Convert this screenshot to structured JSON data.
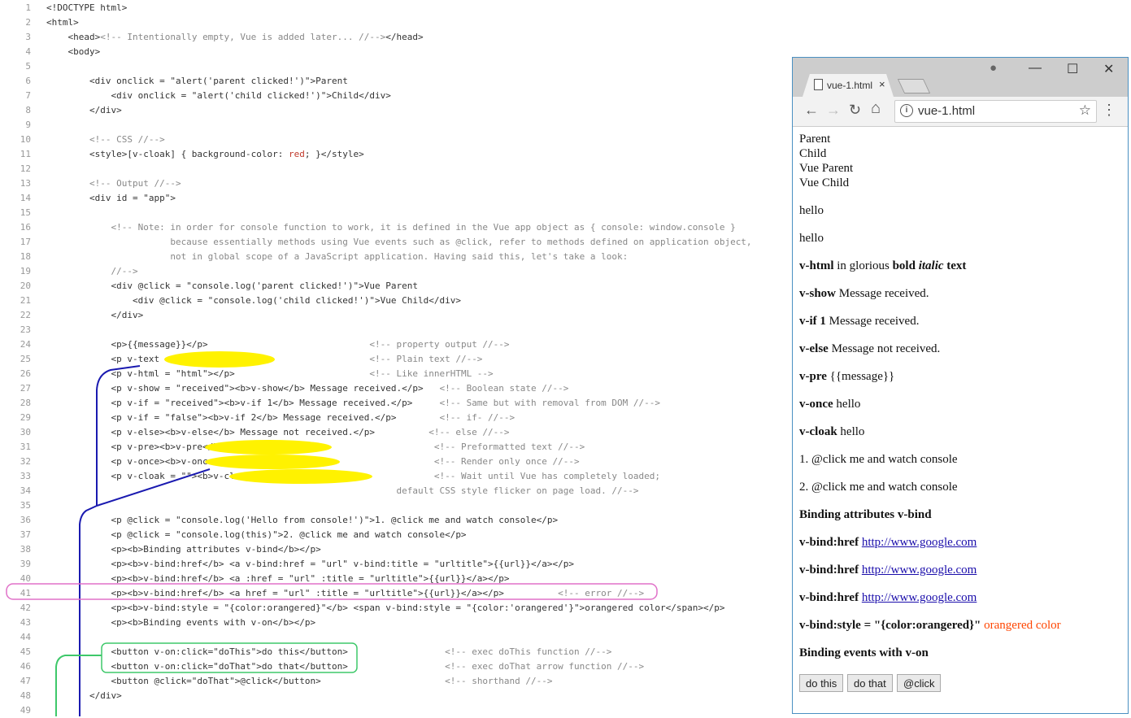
{
  "editor": {
    "lines": [
      {
        "n": "1",
        "segs": [
          [
            "t",
            "<!DOCTYPE html>"
          ]
        ]
      },
      {
        "n": "2",
        "segs": [
          [
            "t",
            "<html>"
          ]
        ]
      },
      {
        "n": "3",
        "segs": [
          [
            "t",
            "    <head>"
          ],
          [
            "c",
            "<!-- Intentionally empty, Vue is added later... //-->"
          ],
          [
            "t",
            "</head>"
          ]
        ]
      },
      {
        "n": "4",
        "segs": [
          [
            "t",
            "    <body>"
          ]
        ]
      },
      {
        "n": "5",
        "segs": []
      },
      {
        "n": "6",
        "segs": [
          [
            "t",
            "        <div onclick = \"alert('parent clicked!')\">Parent"
          ]
        ]
      },
      {
        "n": "7",
        "segs": [
          [
            "t",
            "            <div onclick = \"alert('child clicked!')\">Child</div>"
          ]
        ]
      },
      {
        "n": "8",
        "segs": [
          [
            "t",
            "        </div>"
          ]
        ]
      },
      {
        "n": "9",
        "segs": []
      },
      {
        "n": "10",
        "segs": [
          [
            "c",
            "        <!-- CSS //-->"
          ]
        ]
      },
      {
        "n": "11",
        "segs": [
          [
            "t",
            "        <style>[v-cloak] { background-color: "
          ],
          [
            "r",
            "red"
          ],
          [
            "t",
            "; }</style>"
          ]
        ]
      },
      {
        "n": "12",
        "segs": []
      },
      {
        "n": "13",
        "segs": [
          [
            "c",
            "        <!-- Output //-->"
          ]
        ]
      },
      {
        "n": "14",
        "segs": [
          [
            "t",
            "        <div id = \"app\">"
          ]
        ]
      },
      {
        "n": "15",
        "segs": []
      },
      {
        "n": "16",
        "segs": [
          [
            "c",
            "            <!-- Note: in order for console function to work, it is defined in the Vue app object as { console: window.console }"
          ]
        ]
      },
      {
        "n": "17",
        "segs": [
          [
            "c",
            "                       because essentially methods using Vue events such as @click, refer to methods defined on application object,"
          ]
        ]
      },
      {
        "n": "18",
        "segs": [
          [
            "c",
            "                       not in global scope of a JavaScript application. Having said this, let's take a look:"
          ]
        ]
      },
      {
        "n": "19",
        "segs": [
          [
            "c",
            "            //-->"
          ]
        ]
      },
      {
        "n": "20",
        "segs": [
          [
            "t",
            "            <div @click = \"console.log('parent clicked!')\">Vue Parent"
          ]
        ]
      },
      {
        "n": "21",
        "segs": [
          [
            "t",
            "                <div @click = \"console.log('child clicked!')\">Vue Child</div>"
          ]
        ]
      },
      {
        "n": "22",
        "segs": [
          [
            "t",
            "            </div>"
          ]
        ]
      },
      {
        "n": "23",
        "segs": []
      },
      {
        "n": "24",
        "segs": [
          [
            "t",
            "            <p>{{message}}</p>                              "
          ],
          [
            "c",
            "<!-- property output //-->"
          ]
        ]
      },
      {
        "n": "25",
        "segs": [
          [
            "t",
            "            <p v-text = \"message\"></p>                      "
          ],
          [
            "c",
            "<!-- Plain text //-->"
          ]
        ]
      },
      {
        "n": "26",
        "segs": [
          [
            "t",
            "            <p v-html = \"html\"></p>                         "
          ],
          [
            "c",
            "<!-- Like innerHTML -->"
          ]
        ]
      },
      {
        "n": "27",
        "segs": [
          [
            "t",
            "            <p v-show = \"received\"><b>v-show</b> Message received.</p>   "
          ],
          [
            "c",
            "<!-- Boolean state //-->"
          ]
        ]
      },
      {
        "n": "28",
        "segs": [
          [
            "t",
            "            <p v-if = \"received\"><b>v-if 1</b> Message received.</p>     "
          ],
          [
            "c",
            "<!-- Same but with removal from DOM //-->"
          ]
        ]
      },
      {
        "n": "29",
        "segs": [
          [
            "t",
            "            <p v-if = \"false\"><b>v-if 2</b> Message received.</p>        "
          ],
          [
            "c",
            "<!-- if- //-->"
          ]
        ]
      },
      {
        "n": "30",
        "segs": [
          [
            "t",
            "            <p v-else><b>v-else</b> Message not received.</p>          "
          ],
          [
            "c",
            "<!-- else //-->"
          ]
        ]
      },
      {
        "n": "31",
        "segs": [
          [
            "t",
            "            <p v-pre><b>v-pre</b> {{message}}</p>                       "
          ],
          [
            "c",
            "<!-- Preformatted text //-->"
          ]
        ]
      },
      {
        "n": "32",
        "segs": [
          [
            "t",
            "            <p v-once><b>v-once</b> {{message}}</p>                     "
          ],
          [
            "c",
            "<!-- Render only once //-->"
          ]
        ]
      },
      {
        "n": "33",
        "segs": [
          [
            "t",
            "            <p v-cloak = \"\"><b>v-cloak</b> {{message}}</p>              "
          ],
          [
            "c",
            "<!-- Wait until Vue has completely loaded;"
          ]
        ]
      },
      {
        "n": "34",
        "segs": [
          [
            "c",
            "                                                                 default CSS style flicker on page load. //-->"
          ]
        ]
      },
      {
        "n": "35",
        "segs": []
      },
      {
        "n": "36",
        "segs": [
          [
            "t",
            "            <p @click = \"console.log('Hello from console!')\">1. @click me and watch console</p>"
          ]
        ]
      },
      {
        "n": "37",
        "segs": [
          [
            "t",
            "            <p @click = \"console.log(this)\">2. @click me and watch console</p>"
          ]
        ]
      },
      {
        "n": "38",
        "segs": [
          [
            "t",
            "            <p><b>Binding attributes v-bind</b></p>"
          ]
        ]
      },
      {
        "n": "39",
        "segs": [
          [
            "t",
            "            <p><b>v-bind:href</b> <a v-bind:href = \"url\" v-bind:title = \"urltitle\">{{url}}</a></p>"
          ]
        ]
      },
      {
        "n": "40",
        "segs": [
          [
            "t",
            "            <p><b>v-bind:href</b> <a :href = \"url\" :title = \"urltitle\">{{url}}</a></p>"
          ]
        ]
      },
      {
        "n": "41",
        "segs": [
          [
            "t",
            "            <p><b>v-bind:href</b> <a href = \"url\" :title = \"urltitle\">{{url}}</a></p>          "
          ],
          [
            "c",
            "<!-- error //-->"
          ]
        ]
      },
      {
        "n": "42",
        "segs": [
          [
            "t",
            "            <p><b>v-bind:style = \"{color:orangered}\"</b> <span v-bind:style = \"{color:'orangered'}\">orangered color</span></p>"
          ]
        ]
      },
      {
        "n": "43",
        "segs": [
          [
            "t",
            "            <p><b>Binding events with v-on</b></p>"
          ]
        ]
      },
      {
        "n": "44",
        "segs": []
      },
      {
        "n": "45",
        "segs": [
          [
            "t",
            "            <button v-on:click=\"doThis\">do this</button>                  "
          ],
          [
            "c",
            "<!-- exec doThis function //-->"
          ]
        ]
      },
      {
        "n": "46",
        "segs": [
          [
            "t",
            "            <button v-on:click=\"doThat\">do that</button>                  "
          ],
          [
            "c",
            "<!-- exec doThat arrow function //-->"
          ]
        ]
      },
      {
        "n": "47",
        "segs": [
          [
            "t",
            "            <button @click=\"doThat\">@click</button>                       "
          ],
          [
            "c",
            "<!-- shorthand //-->"
          ]
        ]
      },
      {
        "n": "48",
        "segs": [
          [
            "t",
            "        </div>"
          ]
        ]
      },
      {
        "n": "49",
        "segs": []
      }
    ]
  },
  "annotation_colors": {
    "highlight": "#fff200",
    "arrow": "#1a1ab0",
    "error_box": "#e070c8",
    "button_box": "#3ec86a"
  },
  "browser": {
    "tab_title": "vue-1.html",
    "tab_close": "×",
    "url": "vue-1.html",
    "icons": {
      "profile": "●",
      "minimize": "—",
      "maximize": "☐",
      "close": "✕",
      "back": "←",
      "forward": "→",
      "reload": "↻",
      "home": "⌂",
      "info": "i",
      "star": "☆",
      "menu": "⋮"
    },
    "page": {
      "parent": "Parent",
      "child": "Child",
      "vue_parent": "Vue Parent",
      "vue_child": "Vue Child",
      "message": "hello",
      "v_text": "hello",
      "v_html": {
        "b1": "v-html",
        "t1": " in glorious ",
        "b2": "bold",
        "i": "italic",
        "b3": "text"
      },
      "v_show": {
        "label": "v-show",
        "text": " Message received."
      },
      "v_if": {
        "label": "v-if 1",
        "text": " Message received."
      },
      "v_else": {
        "label": "v-else",
        "text": " Message not received."
      },
      "v_pre": {
        "label": "v-pre",
        "text": " {{message}}"
      },
      "v_once": {
        "label": "v-once",
        "text": " hello"
      },
      "v_cloak": {
        "label": "v-cloak",
        "text": " hello"
      },
      "click1": "1. @click me and watch console",
      "click2": "2. @click me and watch console",
      "binding_heading": "Binding attributes v-bind",
      "bind_rows": [
        {
          "label": "v-bind:href",
          "link": "http://www.google.com"
        },
        {
          "label": "v-bind:href",
          "link": "http://www.google.com"
        },
        {
          "label": "v-bind:href",
          "link": "http://www.google.com"
        }
      ],
      "bind_style": {
        "label": "v-bind:style = \"{color:orangered}\"",
        "text": "orangered color",
        "color": "#ff4500"
      },
      "events_heading": "Binding events with v-on",
      "buttons": [
        "do this",
        "do that",
        "@click"
      ]
    }
  }
}
